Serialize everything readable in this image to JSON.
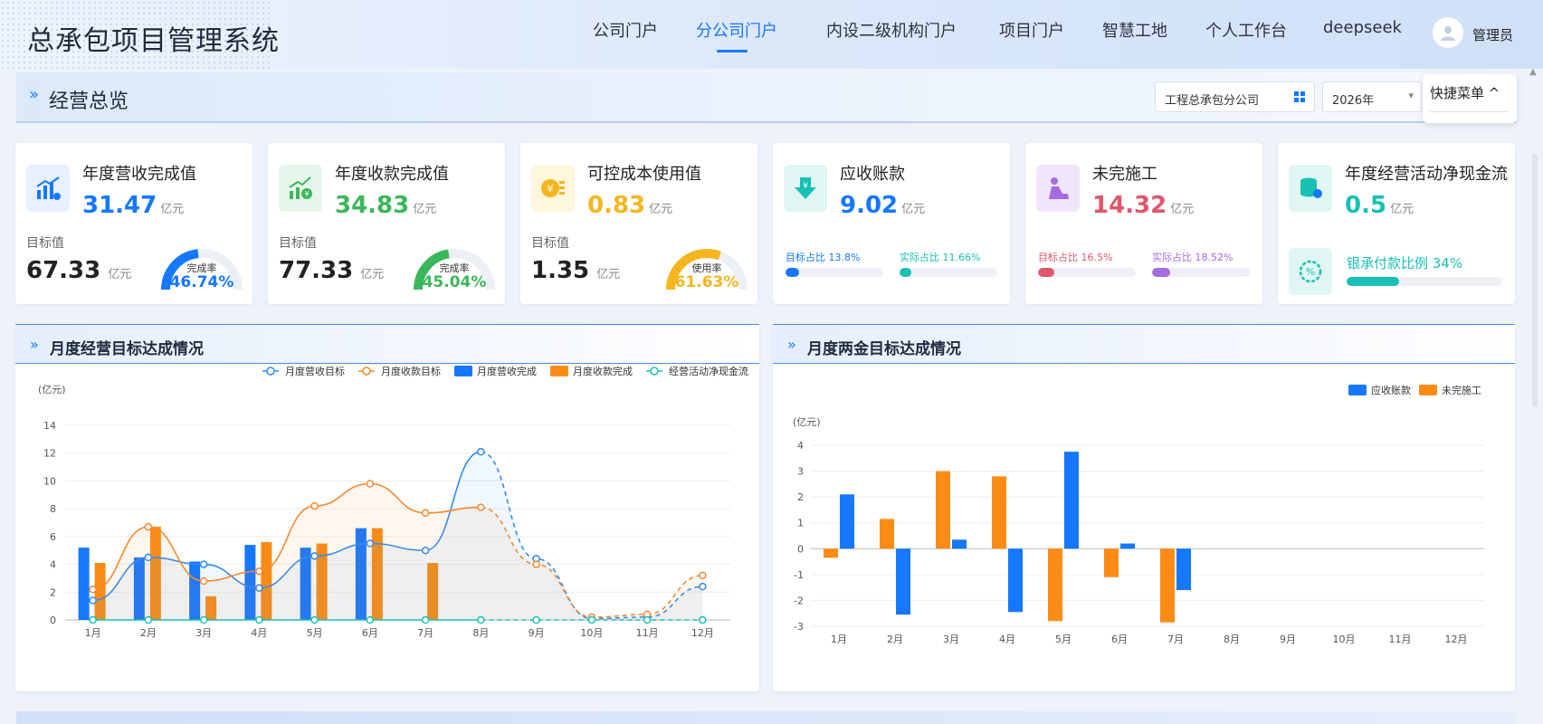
{
  "app": {
    "title": "总承包项目管理系统"
  },
  "nav": {
    "items": [
      "公司门户",
      "分公司门户",
      "内设二级机构门户",
      "项目门户",
      "智慧工地",
      "个人工作台",
      "deepseek"
    ],
    "active": "分公司门户"
  },
  "user": {
    "name": "管理员"
  },
  "section": {
    "title": "经营总览"
  },
  "filters": {
    "company": "工程总承包分公司",
    "year": "2026年"
  },
  "quick_menu": {
    "label": "快捷菜单 ^"
  },
  "kpis": [
    {
      "title": "年度营收完成值",
      "value": "31.47",
      "unit": "亿元",
      "color": "#1677ff",
      "icon": "revenue-chart-icon",
      "target_label": "目标值",
      "target_value": "67.33",
      "target_unit": "亿元",
      "gauge_label": "完成率",
      "gauge_value": "46.74%",
      "gauge_ratio": 0.4674
    },
    {
      "title": "年度收款完成值",
      "value": "34.83",
      "unit": "亿元",
      "color": "#3bb75b",
      "icon": "collection-trend-icon",
      "target_label": "目标值",
      "target_value": "77.33",
      "target_unit": "亿元",
      "gauge_label": "完成率",
      "gauge_value": "45.04%",
      "gauge_ratio": 0.4504
    },
    {
      "title": "可控成本使用值",
      "value": "0.83",
      "unit": "亿元",
      "color": "#f5b51f",
      "icon": "cost-coin-icon",
      "target_label": "目标值",
      "target_value": "1.35",
      "target_unit": "亿元",
      "gauge_label": "使用率",
      "gauge_value": "61.63%",
      "gauge_ratio": 0.6163
    },
    {
      "title": "应收账款",
      "value": "9.02",
      "unit": "亿元",
      "color": "#1677ff",
      "icon": "receivable-download-icon",
      "ratio1_label": "目标占比 13.8%",
      "ratio1": 0.138,
      "ratio1_color": "#1677ff",
      "ratio2_label": "实际占比 11.66%",
      "ratio2": 0.1166,
      "ratio2_color": "#19c0b4"
    },
    {
      "title": "未完施工",
      "value": "14.32",
      "unit": "亿元",
      "color": "#e0566b",
      "icon": "construction-worker-icon",
      "ratio1_label": "目标占比 16.5%",
      "ratio1": 0.165,
      "ratio1_color": "#e0566b",
      "ratio2_label": "实际占比 18.52%",
      "ratio2": 0.1852,
      "ratio2_color": "#a66bdf"
    },
    {
      "title": "年度经营活动净现金流",
      "value": "0.5",
      "unit": "亿元",
      "color": "#19c0b4",
      "icon": "cash-stack-icon",
      "extra_label": "银承付款比例 34%",
      "extra_ratio": 0.34,
      "extra_color": "#19c0b4"
    }
  ],
  "panels": {
    "left_title": "月度经营目标达成情况",
    "right_title": "月度两金目标达成情况"
  },
  "chart_data": [
    {
      "type": "bar",
      "title": "月度经营目标达成情况",
      "ylabel": "(亿元)",
      "ylim": [
        0,
        14
      ],
      "yticks": [
        0,
        2,
        4,
        6,
        8,
        10,
        12,
        14
      ],
      "categories": [
        "1月",
        "2月",
        "3月",
        "4月",
        "5月",
        "6月",
        "7月",
        "8月",
        "9月",
        "10月",
        "11月",
        "12月"
      ],
      "legend_position": "top-right",
      "series": [
        {
          "name": "月度营收目标",
          "kind": "line",
          "color": "#2f8cf0",
          "values": [
            1.4,
            4.5,
            4.0,
            2.3,
            4.6,
            5.5,
            5.0,
            12.1,
            4.4,
            0.1,
            0.2,
            2.4
          ],
          "dashed_from_index": 7
        },
        {
          "name": "月度收款目标",
          "kind": "line",
          "color": "#f5882e",
          "values": [
            2.2,
            6.7,
            2.8,
            3.5,
            8.2,
            9.8,
            7.7,
            8.1,
            4.0,
            0.2,
            0.4,
            3.2
          ],
          "dashed_from_index": 7
        },
        {
          "name": "月度营收完成",
          "kind": "bar",
          "color": "#1677ff",
          "values": [
            5.2,
            4.5,
            4.2,
            5.4,
            5.2,
            6.6,
            0,
            0,
            0,
            0,
            0,
            0
          ]
        },
        {
          "name": "月度收款完成",
          "kind": "bar",
          "color": "#fa8c16",
          "values": [
            4.1,
            6.7,
            1.7,
            5.6,
            5.5,
            6.6,
            4.1,
            0,
            0,
            0,
            0,
            0
          ]
        },
        {
          "name": "经营活动净现金流",
          "kind": "line",
          "color": "#19c0b4",
          "values": [
            0,
            0,
            0,
            0,
            0,
            0,
            0,
            0,
            0,
            0,
            0,
            0
          ],
          "dashed_from_index": 7
        }
      ]
    },
    {
      "type": "bar",
      "title": "月度两金目标达成情况",
      "ylabel": "(亿元)",
      "ylim": [
        -3,
        4
      ],
      "yticks": [
        -3,
        -2,
        -1,
        0,
        1,
        2,
        3,
        4
      ],
      "categories": [
        "1月",
        "2月",
        "3月",
        "4月",
        "5月",
        "6月",
        "7月",
        "8月",
        "9月",
        "10月",
        "11月",
        "12月"
      ],
      "legend_position": "top-right",
      "series": [
        {
          "name": "应收账款",
          "color": "#1677ff",
          "values": [
            2.1,
            -2.55,
            0.35,
            -2.45,
            3.75,
            0.2,
            -1.6,
            0,
            0,
            0,
            0,
            0
          ]
        },
        {
          "name": "未完施工",
          "color": "#fa8c16",
          "values": [
            -0.35,
            1.15,
            3.0,
            2.8,
            -2.8,
            -1.1,
            -2.85,
            0,
            0,
            0,
            0,
            0
          ]
        }
      ]
    }
  ]
}
